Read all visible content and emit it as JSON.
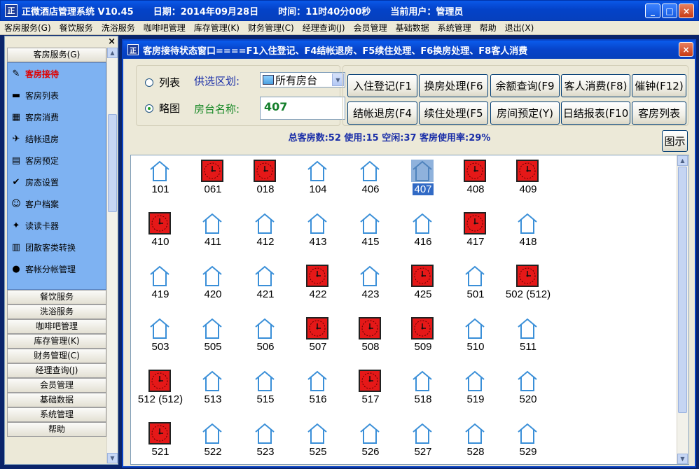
{
  "titlebar": {
    "icon_text": "正",
    "app": "正微酒店管理系统  V10.45",
    "date": "日期：2014年09月28日",
    "time": "时间：11时40分00秒",
    "user": "当前用户：管理员"
  },
  "menu": [
    "客房服务(G)",
    "餐饮服务",
    "洗浴服务",
    "咖啡吧管理",
    "库存管理(K)",
    "财务管理(C)",
    "经理查询(J)",
    "会员管理",
    "基础数据",
    "系统管理",
    "帮助",
    "退出(X)"
  ],
  "sidebar": {
    "close_symbol": "×",
    "active_group": "客房服务(G)",
    "items": [
      {
        "label": "客房接待",
        "icon": "pen-icon",
        "glyph": "✎"
      },
      {
        "label": "客房列表",
        "icon": "bed-icon",
        "glyph": "▬"
      },
      {
        "label": "客房消费",
        "icon": "cash-register-icon",
        "glyph": "▦"
      },
      {
        "label": "结帐退房",
        "icon": "checkout-icon",
        "glyph": "✈"
      },
      {
        "label": "客房预定",
        "icon": "booking-icon",
        "glyph": "▤"
      },
      {
        "label": "房态设置",
        "icon": "settings-doc-icon",
        "glyph": "✔"
      },
      {
        "label": "客户档案",
        "icon": "customer-file-icon",
        "glyph": "☺"
      },
      {
        "label": "读读卡器",
        "icon": "card-reader-icon",
        "glyph": "✦"
      },
      {
        "label": "团散客类转换",
        "icon": "chart-icon",
        "glyph": "▥"
      },
      {
        "label": "客帐分帐管理",
        "icon": "account-icon",
        "glyph": "●"
      }
    ],
    "groups": [
      "餐饮服务",
      "洗浴服务",
      "咖啡吧管理",
      "库存管理(K)",
      "财务管理(C)",
      "经理查询(J)",
      "会员管理",
      "基础数据",
      "系统管理",
      "帮助"
    ]
  },
  "window": {
    "title": "客房接待状态窗口====F1入住登记、F4结帐退房、F5续住处理、F6换房处理、F8客人消费",
    "close_symbol": "×",
    "view_list": "列表",
    "view_map": "略图",
    "selected_view": "略图",
    "area_label": "供选区划:",
    "area_value": "所有房台",
    "room_name_label": "房台名称:",
    "room_name_value": "407",
    "buttons": [
      "入住登记(F1",
      "换房处理(F6",
      "余额查询(F9",
      "客人消费(F8)",
      "催钟(F12)",
      "结帐退房(F4",
      "续住处理(F5",
      "房间预定(Y)",
      "日结报表(F10",
      "客房列表"
    ],
    "stats": "总客房数:52  使用:15  空闲:37    客房使用率:29%",
    "legend_button": "图示",
    "selected_room": "407",
    "colors": {
      "occupied": "#e51818",
      "vacant": "#3a8fd8",
      "selection": "#316ac5"
    },
    "rooms": [
      {
        "n": "101",
        "s": "vacant"
      },
      {
        "n": "061",
        "s": "occupied"
      },
      {
        "n": "018",
        "s": "occupied"
      },
      {
        "n": "104",
        "s": "vacant"
      },
      {
        "n": "406",
        "s": "vacant"
      },
      {
        "n": "407",
        "s": "vacant"
      },
      {
        "n": "408",
        "s": "occupied"
      },
      {
        "n": "409",
        "s": "occupied"
      },
      {
        "n": "410",
        "s": "occupied"
      },
      {
        "n": "411",
        "s": "vacant"
      },
      {
        "n": "412",
        "s": "vacant"
      },
      {
        "n": "413",
        "s": "vacant"
      },
      {
        "n": "415",
        "s": "vacant"
      },
      {
        "n": "416",
        "s": "vacant"
      },
      {
        "n": "417",
        "s": "occupied"
      },
      {
        "n": "418",
        "s": "vacant"
      },
      {
        "n": "419",
        "s": "vacant"
      },
      {
        "n": "420",
        "s": "vacant"
      },
      {
        "n": "421",
        "s": "vacant"
      },
      {
        "n": "422",
        "s": "occupied"
      },
      {
        "n": "423",
        "s": "vacant"
      },
      {
        "n": "425",
        "s": "occupied"
      },
      {
        "n": "501",
        "s": "vacant"
      },
      {
        "n": "502 (512)",
        "s": "occupied"
      },
      {
        "n": "503",
        "s": "vacant"
      },
      {
        "n": "505",
        "s": "vacant"
      },
      {
        "n": "506",
        "s": "vacant"
      },
      {
        "n": "507",
        "s": "occupied"
      },
      {
        "n": "508",
        "s": "occupied"
      },
      {
        "n": "509",
        "s": "occupied"
      },
      {
        "n": "510",
        "s": "vacant"
      },
      {
        "n": "511",
        "s": "vacant"
      },
      {
        "n": "512 (512)",
        "s": "occupied"
      },
      {
        "n": "513",
        "s": "vacant"
      },
      {
        "n": "515",
        "s": "vacant"
      },
      {
        "n": "516",
        "s": "vacant"
      },
      {
        "n": "517",
        "s": "occupied"
      },
      {
        "n": "518",
        "s": "vacant"
      },
      {
        "n": "519",
        "s": "vacant"
      },
      {
        "n": "520",
        "s": "vacant"
      },
      {
        "n": "521",
        "s": "occupied"
      },
      {
        "n": "522",
        "s": "vacant"
      },
      {
        "n": "523",
        "s": "vacant"
      },
      {
        "n": "525",
        "s": "vacant"
      },
      {
        "n": "526",
        "s": "vacant"
      },
      {
        "n": "527",
        "s": "vacant"
      },
      {
        "n": "528",
        "s": "vacant"
      },
      {
        "n": "529",
        "s": "vacant"
      }
    ]
  }
}
